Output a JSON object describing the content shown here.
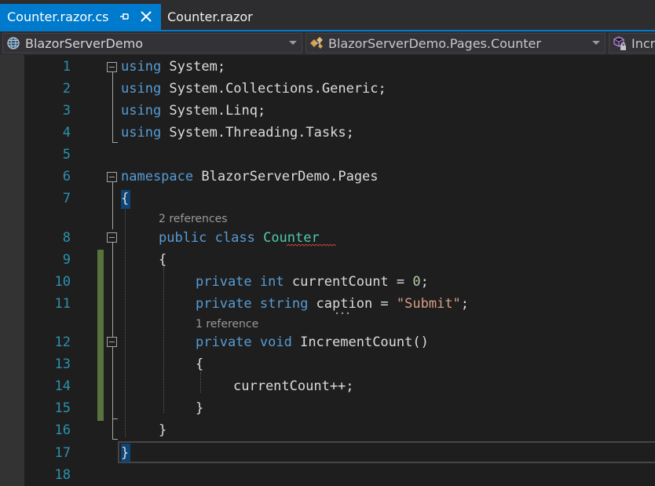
{
  "tabs": [
    {
      "label": "Counter.razor.cs",
      "active": true
    },
    {
      "label": "Counter.razor",
      "active": false
    }
  ],
  "navbar": {
    "project": "BlazorServerDemo",
    "type": "BlazorServerDemo.Pages.Counter",
    "member": "Incr"
  },
  "editor": {
    "line_numbers": [
      "1",
      "2",
      "3",
      "4",
      "5",
      "6",
      "7",
      "8",
      "9",
      "10",
      "11",
      "12",
      "13",
      "14",
      "15",
      "16",
      "17",
      "18"
    ],
    "lines": {
      "l1": {
        "kw": "using",
        "rest": " System;"
      },
      "l2": {
        "kw": "using",
        "rest": " System.Collections.Generic;"
      },
      "l3": {
        "kw": "using",
        "rest": " System.Linq;"
      },
      "l4": {
        "kw": "using",
        "rest": " System.Threading.Tasks;"
      },
      "l6": {
        "kw": "namespace",
        "rest": " BlazorServerDemo.Pages"
      },
      "l7": {
        "text": "{"
      },
      "l8": {
        "kw1": "public",
        "kw2": " class ",
        "type": "Counter"
      },
      "l9": {
        "text": "{"
      },
      "l10": {
        "kw1": "private",
        "kw2": " int",
        "rest": " currentCount = ",
        "num": "0",
        "end": ";"
      },
      "l11": {
        "kw1": "private",
        "kw2": " string",
        "rest": " caption = ",
        "str": "\"Submit\"",
        "end": ";"
      },
      "l12": {
        "kw1": "private",
        "kw2": " void",
        "rest": " IncrementCount()"
      },
      "l13": {
        "text": "{"
      },
      "l14": {
        "text": "currentCount++;"
      },
      "l15": {
        "text": "}"
      },
      "l16": {
        "text": "}"
      },
      "l17": {
        "text": "}"
      }
    },
    "codelens": {
      "class_refs": "2 references",
      "method_refs": "1 reference"
    }
  },
  "colors": {
    "keyword": "#569cd6",
    "type": "#4ec9b0",
    "string": "#d69d85",
    "number": "#b5cea8",
    "line_number": "#2b91af",
    "accent": "#007acc",
    "change_bar": "#57743e"
  },
  "icons": {
    "tab_pin": "pin-icon",
    "tab_close": "close-icon",
    "project": "globe-project-icon",
    "type": "class-icon",
    "member": "method-lock-icon"
  }
}
